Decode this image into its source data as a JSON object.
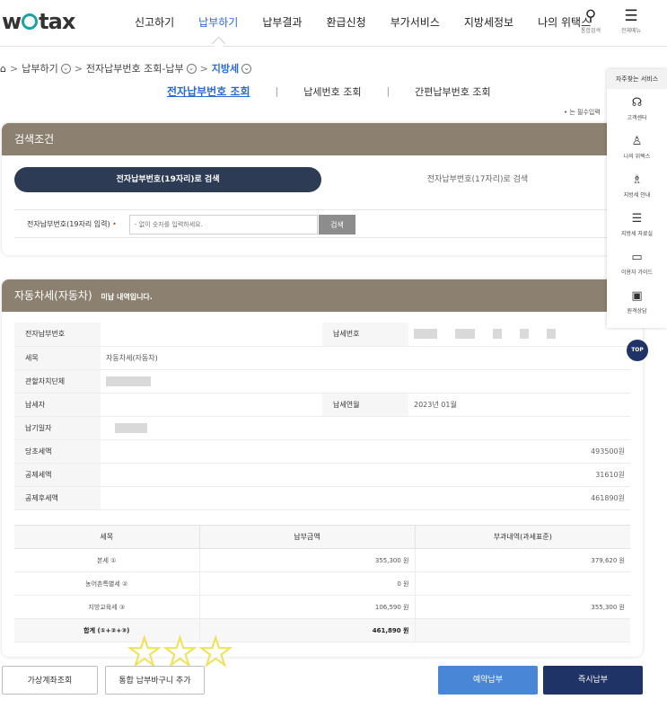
{
  "header": {
    "logo": "wetax",
    "nav": [
      "신고하기",
      "납부하기",
      "납부결과",
      "환급신청",
      "부가서비스",
      "지방세정보",
      "나의 위택스"
    ],
    "active_nav": 1,
    "search_label": "통합검색",
    "menu_label": "전체메뉴"
  },
  "breadcrumb": {
    "items": [
      "납부하기",
      "전자납부번호 조회-납부"
    ],
    "current": "지방세"
  },
  "subtabs": [
    {
      "label": "전자납부번호 조회",
      "active": true
    },
    {
      "label": "납세번호 조회",
      "active": false
    },
    {
      "label": "간편납부번호 조회",
      "active": false
    }
  ],
  "required_note": "• 는 필수입력",
  "search": {
    "title": "검색조건",
    "seg_on": "전자납부번호(19자리)로 검색",
    "seg_off": "전자납부번호(17자리)로 검색",
    "field_label": "전자납부번호(19자리 입력)",
    "required_mark": "•",
    "placeholder": "- 없이 숫자를 입력하세요.",
    "button": "검색"
  },
  "result": {
    "title": "자동차세(자동차)",
    "status": "미납 내역입니다.",
    "rows": {
      "epay_label": "전자납부번호",
      "taxno_label": "납세번호",
      "item_label": "세목",
      "item_value": "자동차세(자동차)",
      "office_label": "관할자치단체",
      "payer_label": "납세자",
      "period_label": "납세연월",
      "period_value": "2023년 01월",
      "due_label": "납기일자",
      "orig_label": "당초세액",
      "orig_value": "493500원",
      "deduct_label": "공제세액",
      "deduct_value": "31610원",
      "after_label": "공제후세액",
      "after_value": "461890원"
    },
    "tax_table": {
      "headers": [
        "세목",
        "납부금액",
        "부과내역(과세표준)"
      ],
      "rows": [
        {
          "name": "본세 ①",
          "amount": "355,300 원",
          "base": "379,620 원"
        },
        {
          "name": "농어촌특별세 ②",
          "amount": "0 원",
          "base": ""
        },
        {
          "name": "지방교육세 ③",
          "amount": "106,590 원",
          "base": "355,300 원"
        },
        {
          "name": "합계 (①+②+③)",
          "amount": "461,890 원",
          "base": ""
        }
      ]
    }
  },
  "buttons": {
    "virtual_account": "가상계좌조회",
    "add_cart": "통합 납부바구니 추가",
    "reserve": "예약납부",
    "pay_now": "즉시납부"
  },
  "quick": {
    "title": "자주찾는 서비스",
    "items": [
      {
        "icon": "headset-icon",
        "glyph": "☊",
        "label": "고객센터"
      },
      {
        "icon": "person-icon",
        "glyph": "♙",
        "label": "나의 위택스"
      },
      {
        "icon": "bag-icon",
        "glyph": "♗",
        "label": "지방세 안내"
      },
      {
        "icon": "list-icon",
        "glyph": "☰",
        "label": "지방세 자료실"
      },
      {
        "icon": "chat-icon",
        "glyph": "▭",
        "label": "이용자 가이드"
      },
      {
        "icon": "monitor-icon",
        "glyph": "▣",
        "label": "원격상담"
      }
    ],
    "top": "TOP"
  },
  "colors": {
    "accent_blue": "#2a6ad1",
    "panel_header": "#8c8070",
    "navy": "#1f3366",
    "button_blue": "#4a86d6",
    "logo_teal": "#1aa3a3",
    "required": "#d94f00"
  }
}
